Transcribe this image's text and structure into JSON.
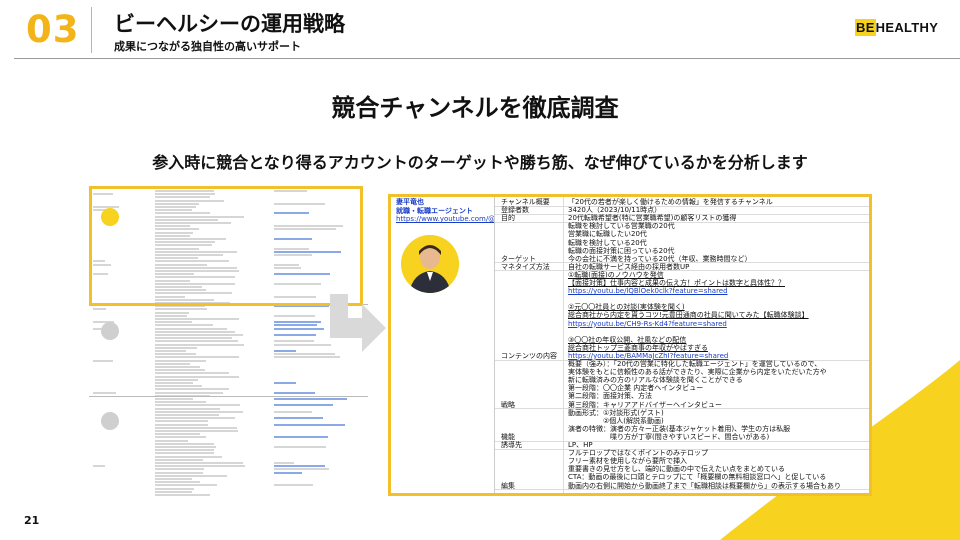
{
  "header": {
    "section_number": "03",
    "title": "ビーヘルシーの運用戦略",
    "subtitle": "成果につながる独自性の高いサポート",
    "logo_prefix": "BE",
    "logo_suffix": "HEALTHY"
  },
  "main": {
    "headline": "競合チャンネルを徹底調査",
    "lead": "参入時に競合となり得るアカウントのターゲットや勝ち筋、なぜ伸びているかを分析します"
  },
  "panel": {
    "channel_name": "妻平竜也",
    "channel_tag": "就職・転職エージェント",
    "channel_url": "https://www.youtube.com/@user-g",
    "rows": [
      {
        "label": "チャンネル概要",
        "value": "「20代の若者が楽しく働けるための情報」を発信するチャンネル"
      },
      {
        "label": "登録者数",
        "value": "3420人（2023/10/11時点）"
      },
      {
        "label": "目的",
        "value": "20代転職希望者(特に営業職希望)の顧客リストの獲得"
      },
      {
        "label": "",
        "value": "転職を検討している営業職の20代"
      },
      {
        "label": "",
        "value": "営業職に転職したい20代"
      },
      {
        "label": "",
        "value": "転職を検討している20代"
      },
      {
        "label": "",
        "value": "転職の面接対策に困っている20代"
      },
      {
        "label": "ターゲット",
        "value": "今の会社に不満を持っている20代（年収、業務時間など）"
      },
      {
        "label": "マネタイズ方法",
        "value": "自社の転職サービス経由の採用者数UP"
      },
      {
        "label": "",
        "value": "①転職(面接)のノウハウを発信"
      },
      {
        "label": "",
        "value": "【面接対策】仕事内容と成果の伝え方！ポイントは数字と具体性？？"
      },
      {
        "label": "",
        "value": "https://youtu.be/lQBlOek0clk?feature=shared"
      },
      {
        "label": "",
        "value": ""
      },
      {
        "label": "",
        "value": "②元〇〇社員との対談(実体験を聞く)"
      },
      {
        "label": "",
        "value": "総合商社から内定を貰うコツ!元豊田通商の社員に聞いてみた【転職体験談】"
      },
      {
        "label": "",
        "value": "https://youtu.be/CH9-Rs-Kd4?feature=shared"
      },
      {
        "label": "",
        "value": ""
      },
      {
        "label": "",
        "value": "③〇〇社の年収公開、社風などの配信"
      },
      {
        "label": "",
        "value": "総合商社トップ三菱商事の年収がやばすぎる"
      },
      {
        "label": "コンテンツの内容",
        "value": "https://youtu.be/BAMMaJcZhI?feature=shared"
      },
      {
        "label": "",
        "value": "概要（強み）：「20代の営業に特化した転職エージェント」を運営しているので、"
      },
      {
        "label": "",
        "value": "実体験をもとに信頼性のある話ができたり、実際に企業から内定をいただいた方や"
      },
      {
        "label": "",
        "value": "新に転職済みの方のリアルな体験談を聞くことができる"
      },
      {
        "label": "",
        "value": "第一段階：〇〇企業 内定者ヘインタビュー"
      },
      {
        "label": "",
        "value": "第二段階：面接対策、方法"
      },
      {
        "label": "戦略",
        "value": "第三段階：キャリアアドバイザーヘインタビュー"
      },
      {
        "label": "",
        "value": "動画形式：①対談形式(ゲスト)"
      },
      {
        "label": "",
        "value": "　　　　　②個人(解説系動画)"
      },
      {
        "label": "",
        "value": "演者の特徴：演者の方々ー正装(基本ジャケット着用)、学生の方は私服"
      },
      {
        "label": "機能",
        "value": "　　　　　　喋り方が丁寧(間きやすいスピード、間合いがある)"
      },
      {
        "label": "誘導先",
        "value": "LP、HP"
      },
      {
        "label": "",
        "value": "フルテロップではなくポイントのみテロップ"
      },
      {
        "label": "",
        "value": "フリー素材を使用しながら要所で挿入"
      },
      {
        "label": "",
        "value": "重要書きの見せ方をし、端的に動画の中で伝えたい点をまとめている"
      },
      {
        "label": "",
        "value": "CTA：動画の最後に口頭とテロップにて「概要欄の無料相談窓口へ」と促している"
      },
      {
        "label": "編集",
        "value": "動画内の右側に開始から動画終了まで「転職相談は概要欄から」の表示する場合もあり"
      }
    ]
  },
  "footer": {
    "page_number": "21"
  },
  "colors": {
    "accent": "#f2b418",
    "highlight": "#f2c12a",
    "link": "#1a3dc8"
  }
}
